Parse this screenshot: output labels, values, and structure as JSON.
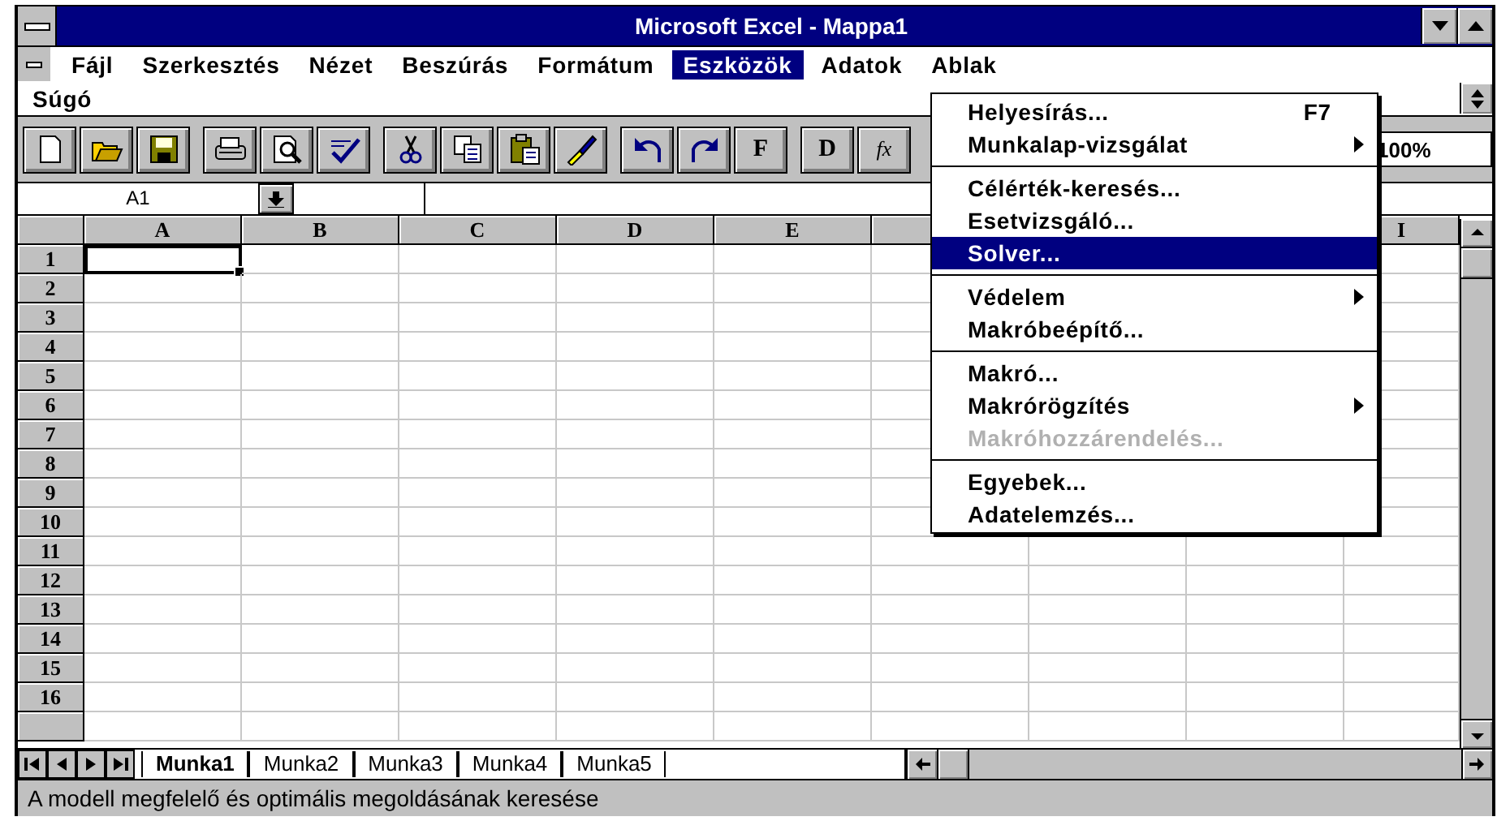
{
  "window": {
    "title": "Microsoft Excel - Mappa1"
  },
  "menu_bar": [
    {
      "label": "Fájl",
      "selected": false
    },
    {
      "label": "Szerkesztés",
      "selected": false
    },
    {
      "label": "Nézet",
      "selected": false
    },
    {
      "label": "Beszúrás",
      "selected": false
    },
    {
      "label": "Formátum",
      "selected": false
    },
    {
      "label": "Eszközök",
      "selected": true
    },
    {
      "label": "Adatok",
      "selected": false
    },
    {
      "label": "Ablak",
      "selected": false
    },
    {
      "label": "Súgó",
      "selected": false
    }
  ],
  "toolbar": [
    {
      "kind": "new"
    },
    {
      "kind": "open"
    },
    {
      "kind": "save"
    },
    {
      "kind": "sep"
    },
    {
      "kind": "print"
    },
    {
      "kind": "preview"
    },
    {
      "kind": "spell"
    },
    {
      "kind": "sep"
    },
    {
      "kind": "cut"
    },
    {
      "kind": "copy"
    },
    {
      "kind": "paste"
    },
    {
      "kind": "brush"
    },
    {
      "kind": "sep"
    },
    {
      "kind": "undo"
    },
    {
      "kind": "redo"
    },
    {
      "kind": "text",
      "text": "F"
    },
    {
      "kind": "sep"
    },
    {
      "kind": "text",
      "text": "D"
    },
    {
      "kind": "text",
      "text": "fx"
    }
  ],
  "zoom": {
    "value": "100%"
  },
  "formula_bar": {
    "name_box": "A1"
  },
  "columns": [
    "A",
    "B",
    "C",
    "D",
    "E"
  ],
  "columns_right_of_menu": [
    "I"
  ],
  "rows": [
    "1",
    "2",
    "3",
    "4",
    "5",
    "6",
    "7",
    "8",
    "9",
    "10",
    "11",
    "12",
    "13",
    "14",
    "15",
    "16"
  ],
  "sheet_tabs": [
    {
      "label": "Munka1",
      "selected": true
    },
    {
      "label": "Munka2",
      "selected": false
    },
    {
      "label": "Munka3",
      "selected": false
    },
    {
      "label": "Munka4",
      "selected": false
    },
    {
      "label": "Munka5",
      "selected": false
    }
  ],
  "dropdown": [
    {
      "label": "Helyesírás...",
      "shortcut": "F7",
      "submenu": false,
      "disabled": false,
      "selected": false
    },
    {
      "label": "Munkalap-vizsgálat",
      "submenu": true,
      "disabled": false,
      "selected": false
    },
    {
      "kind": "separator"
    },
    {
      "label": "Célérték-keresés...",
      "submenu": false,
      "disabled": false,
      "selected": false
    },
    {
      "label": "Esetvizsgáló...",
      "submenu": false,
      "disabled": false,
      "selected": false
    },
    {
      "label": "Solver...",
      "submenu": false,
      "disabled": false,
      "selected": true
    },
    {
      "kind": "separator"
    },
    {
      "label": "Védelem",
      "submenu": true,
      "disabled": false,
      "selected": false
    },
    {
      "label": "Makróbeépítő...",
      "submenu": false,
      "disabled": false,
      "selected": false
    },
    {
      "kind": "separator"
    },
    {
      "label": "Makró...",
      "submenu": false,
      "disabled": false,
      "selected": false
    },
    {
      "label": "Makrórögzítés",
      "submenu": true,
      "disabled": false,
      "selected": false
    },
    {
      "label": "Makróhozzárendelés...",
      "submenu": false,
      "disabled": true,
      "selected": false
    },
    {
      "kind": "separator"
    },
    {
      "label": "Egyebek...",
      "submenu": false,
      "disabled": false,
      "selected": false
    },
    {
      "label": "Adatelemzés...",
      "submenu": false,
      "disabled": false,
      "selected": false
    }
  ],
  "status_bar": {
    "text": "A modell megfelelő és optimális megoldásának keresése"
  }
}
